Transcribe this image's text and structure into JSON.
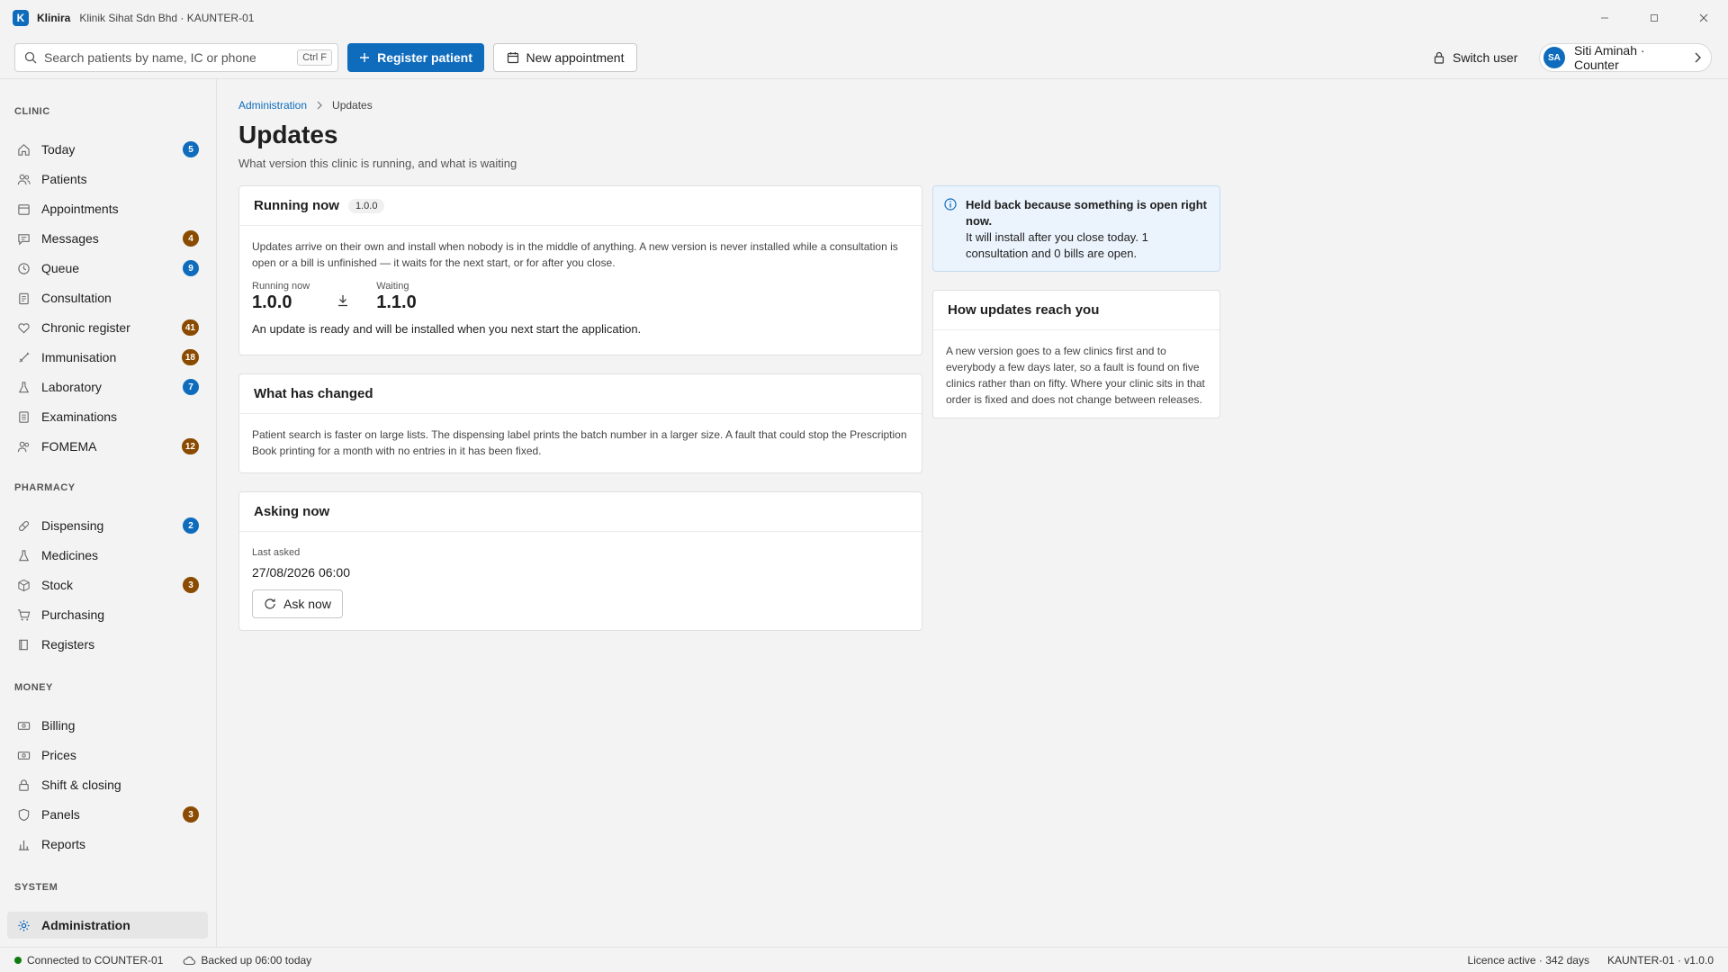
{
  "window": {
    "app_logo_letter": "K",
    "app_name": "Klinira",
    "subtitle": "Klinik Sihat Sdn Bhd · KAUNTER-01"
  },
  "toolbar": {
    "search_placeholder": "Search patients by name, IC or phone",
    "search_shortcut": "Ctrl F",
    "register_label": "Register patient",
    "appointment_label": "New appointment",
    "switch_user_label": "Switch user",
    "user_initials": "SA",
    "user_label": "Siti Aminah · Counter"
  },
  "sidebar": {
    "clinic_heading": "CLINIC",
    "pharmacy_heading": "PHARMACY",
    "money_heading": "MONEY",
    "system_heading": "SYSTEM",
    "clinic_items": [
      {
        "label": "Today",
        "badge": "5",
        "badge_color": "#0f6cbd"
      },
      {
        "label": "Patients",
        "badge": null
      },
      {
        "label": "Appointments",
        "badge": null
      },
      {
        "label": "Messages",
        "badge": "4",
        "badge_color": "#8a4b00"
      },
      {
        "label": "Queue",
        "badge": "9",
        "badge_color": "#0f6cbd"
      },
      {
        "label": "Consultation",
        "badge": null
      },
      {
        "label": "Chronic register",
        "badge": "41",
        "badge_color": "#8a4b00"
      },
      {
        "label": "Immunisation",
        "badge": "18",
        "badge_color": "#8a4b00"
      },
      {
        "label": "Laboratory",
        "badge": "7",
        "badge_color": "#0f6cbd"
      },
      {
        "label": "Examinations",
        "badge": null
      },
      {
        "label": "FOMEMA",
        "badge": "12",
        "badge_color": "#8a4b00"
      }
    ],
    "pharmacy_items": [
      {
        "label": "Dispensing",
        "badge": "2",
        "badge_color": "#0f6cbd"
      },
      {
        "label": "Medicines",
        "badge": null
      },
      {
        "label": "Stock",
        "badge": "3",
        "badge_color": "#8a4b00"
      },
      {
        "label": "Purchasing",
        "badge": null
      },
      {
        "label": "Registers",
        "badge": null
      }
    ],
    "money_items": [
      {
        "label": "Billing",
        "badge": null
      },
      {
        "label": "Prices",
        "badge": null
      },
      {
        "label": "Shift & closing",
        "badge": null
      },
      {
        "label": "Panels",
        "badge": "3",
        "badge_color": "#8a4b00"
      },
      {
        "label": "Reports",
        "badge": null
      }
    ],
    "system_items": [
      {
        "label": "Administration",
        "badge": null,
        "active": true
      }
    ]
  },
  "main": {
    "breadcrumb_parent": "Administration",
    "breadcrumb_current": "Updates",
    "title": "Updates",
    "subtitle": "What version this clinic is running, and what is waiting",
    "running_card": {
      "title": "Running now",
      "version_pill": "1.0.0",
      "description": "Updates arrive on their own and install when nobody is in the middle of anything. A new version is never installed while a consultation is open or a bill is unfinished — it waits for the next start, or for after you close.",
      "running_label": "Running now",
      "running_value": "1.0.0",
      "waiting_label": "Waiting",
      "waiting_value": "1.1.0",
      "ready_text": "An update is ready and will be installed when you next start the application."
    },
    "changes_card": {
      "title": "What has changed",
      "text": "Patient search is faster on large lists. The dispensing label prints the batch number in a larger size. A fault that could stop the Prescription Book printing for a month with no entries in it has been fixed."
    },
    "asking_card": {
      "title": "Asking now",
      "last_asked_label": "Last asked",
      "last_asked_value": "27/08/2026 06:00",
      "ask_button": "Ask now"
    },
    "held_notice": {
      "title": "Held back because something is open right now.",
      "text": "It will install after you close today. 1 consultation and 0 bills are open."
    },
    "how_card": {
      "title": "How updates reach you",
      "text": "A new version goes to a few clinics first and to everybody a few days later, so a fault is found on five clinics rather than on fifty. Where your clinic sits in that order is fixed and does not change between releases."
    }
  },
  "statusbar": {
    "connection": "Connected to COUNTER-01",
    "backup": "Backed up 06:00 today",
    "licence": "Licence active · 342 days",
    "version": "KAUNTER-01 · v1.0.0"
  },
  "colors": {
    "accent": "#0f6cbd",
    "badge_amber": "#8a4b00",
    "online_green": "#107c10",
    "notice_bg": "#ebf3fc"
  }
}
